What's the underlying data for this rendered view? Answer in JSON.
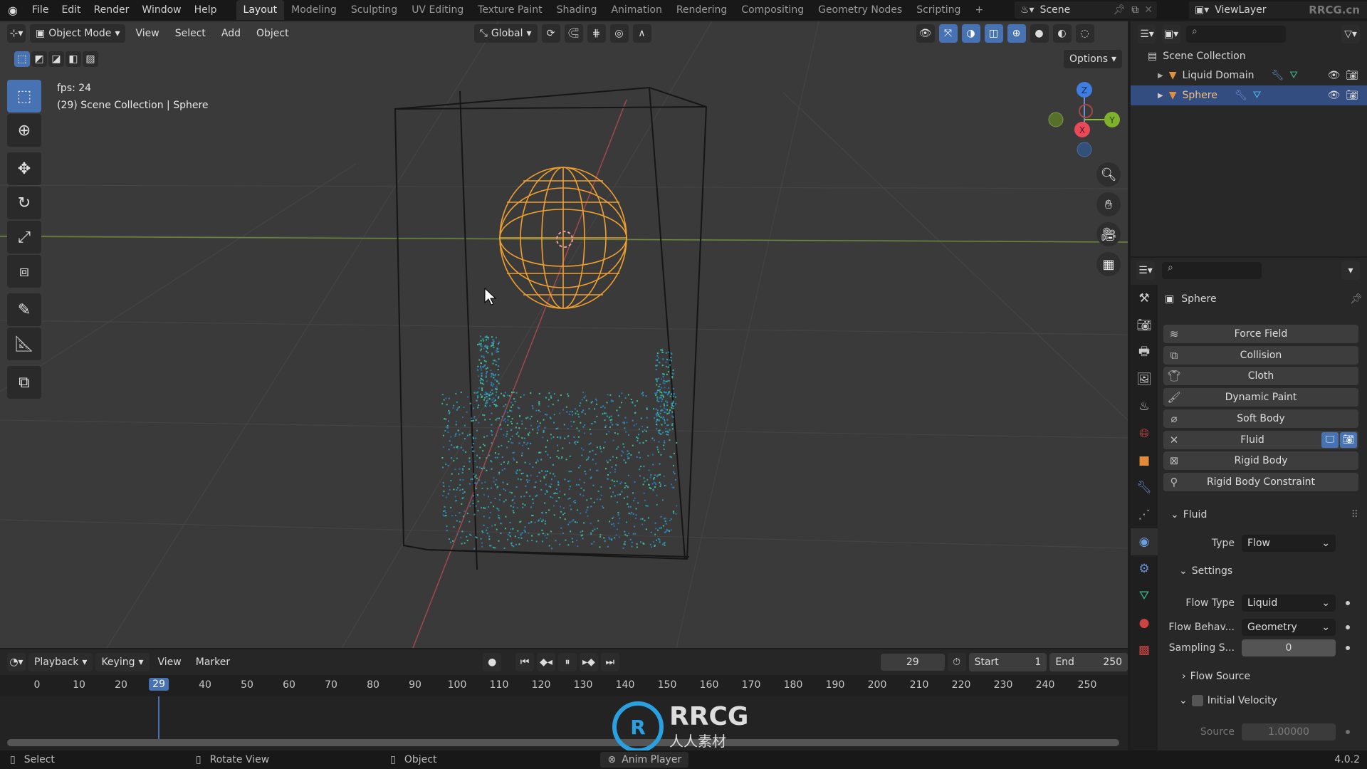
{
  "topbar": {
    "menus": [
      "File",
      "Edit",
      "Render",
      "Window",
      "Help"
    ],
    "workspaces": [
      "Layout",
      "Modeling",
      "Sculpting",
      "UV Editing",
      "Texture Paint",
      "Shading",
      "Animation",
      "Rendering",
      "Compositing",
      "Geometry Nodes",
      "Scripting"
    ],
    "active_workspace": "Layout",
    "add_tab": "+",
    "scene": "Scene",
    "view_layer": "ViewLayer"
  },
  "viewport": {
    "mode": "Object Mode",
    "menus": [
      "View",
      "Select",
      "Add",
      "Object"
    ],
    "transform_orientation": "Global",
    "options_label": "Options",
    "fps": "fps: 24",
    "info": "(29) Scene Collection | Sphere",
    "gizmo": {
      "z": "Z",
      "y": "Y",
      "x": "X"
    }
  },
  "outliner": {
    "root": "Scene Collection",
    "items": [
      {
        "name": "Liquid Domain",
        "selected": false
      },
      {
        "name": "Sphere",
        "selected": true
      }
    ]
  },
  "properties": {
    "object_name": "Sphere",
    "physics_buttons": [
      {
        "label": "Force Field",
        "icon": "force-field"
      },
      {
        "label": "Collision",
        "icon": "collision"
      },
      {
        "label": "Cloth",
        "icon": "cloth"
      },
      {
        "label": "Dynamic Paint",
        "icon": "dynamic-paint"
      },
      {
        "label": "Soft Body",
        "icon": "soft-body"
      },
      {
        "label": "Fluid",
        "icon": "close",
        "enabled": true
      },
      {
        "label": "Rigid Body",
        "icon": "rigid-body"
      },
      {
        "label": "Rigid Body Constraint",
        "icon": "rigid-body-constraint"
      }
    ],
    "fluid_panel": {
      "title": "Fluid",
      "type_label": "Type",
      "type_value": "Flow",
      "settings_title": "Settings",
      "flow_type_label": "Flow Type",
      "flow_type_value": "Liquid",
      "flow_behavior_label": "Flow Behav...",
      "flow_behavior_value": "Geometry",
      "sampling_label": "Sampling S...",
      "sampling_value": "0",
      "flow_source_title": "Flow Source",
      "initial_velocity_title": "Initial Velocity",
      "source_label": "Source",
      "source_value": "1.00000"
    }
  },
  "timeline": {
    "menus": [
      "Playback",
      "Keying",
      "View",
      "Marker"
    ],
    "current_frame": "29",
    "start_label": "Start",
    "start": "1",
    "end_label": "End",
    "end": "250",
    "ticks": [
      "0",
      "10",
      "20",
      "29",
      "40",
      "50",
      "60",
      "70",
      "80",
      "90",
      "100",
      "110",
      "120",
      "130",
      "140",
      "150",
      "160",
      "170",
      "180",
      "190",
      "200",
      "210",
      "220",
      "230",
      "240",
      "250"
    ]
  },
  "statusbar": {
    "select": "Select",
    "rotate": "Rotate View",
    "object": "Object",
    "anim_player": "Anim Player",
    "version": "4.0.2"
  },
  "watermark": {
    "brand": "RRCG",
    "sub": "人人素材",
    "corner": "RRCG.cn"
  }
}
